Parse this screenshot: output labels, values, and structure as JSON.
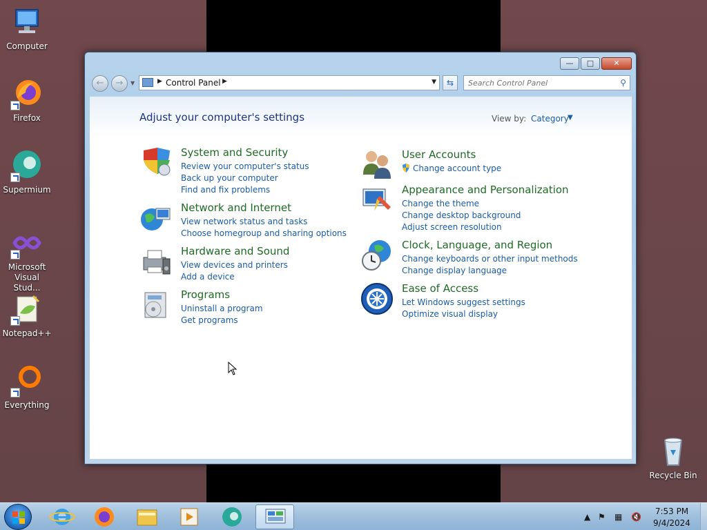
{
  "desktop": {
    "icons": [
      {
        "label": "Computer",
        "icon": "computer-icon"
      },
      {
        "label": "Firefox",
        "icon": "firefox-icon"
      },
      {
        "label": "Supermium",
        "icon": "supermium-icon"
      },
      {
        "label": "Microsoft Visual Stud...",
        "icon": "visual-studio-icon"
      },
      {
        "label": "Notepad++",
        "icon": "notepadpp-icon"
      },
      {
        "label": "Everything",
        "icon": "everything-icon"
      },
      {
        "label": "Recycle Bin",
        "icon": "recycle-bin-icon"
      }
    ]
  },
  "window": {
    "address": {
      "crumb": "Control Panel"
    },
    "search": {
      "placeholder": "Search Control Panel"
    },
    "title": "Adjust your computer's settings",
    "view_by": {
      "label": "View by:",
      "value": "Category"
    },
    "categories": [
      {
        "title": "System and Security",
        "icon": "shield-icon",
        "links": [
          "Review your computer's status",
          "Back up your computer",
          "Find and fix problems"
        ]
      },
      {
        "title": "Network and Internet",
        "icon": "network-globe-icon",
        "links": [
          "View network status and tasks",
          "Choose homegroup and sharing options"
        ]
      },
      {
        "title": "Hardware and Sound",
        "icon": "printer-icon",
        "links": [
          "View devices and printers",
          "Add a device"
        ]
      },
      {
        "title": "Programs",
        "icon": "programs-icon",
        "links": [
          "Uninstall a program",
          "Get programs"
        ]
      },
      {
        "title": "User Accounts",
        "icon": "users-icon",
        "links": [
          "Change account type"
        ]
      },
      {
        "title": "Appearance and Personalization",
        "icon": "appearance-icon",
        "links": [
          "Change the theme",
          "Change desktop background",
          "Adjust screen resolution"
        ]
      },
      {
        "title": "Clock, Language, and Region",
        "icon": "clock-globe-icon",
        "links": [
          "Change keyboards or other input methods",
          "Change display language"
        ]
      },
      {
        "title": "Ease of Access",
        "icon": "ease-of-access-icon",
        "links": [
          "Let Windows suggest settings",
          "Optimize visual display"
        ]
      }
    ]
  },
  "taskbar": {
    "apps": [
      "start-orb",
      "internet-explorer-icon",
      "firefox-icon",
      "file-explorer-icon",
      "media-player-icon",
      "supermium-icon",
      "control-panel-icon"
    ],
    "clock": {
      "time": "7:53 PM",
      "date": "9/4/2024"
    }
  }
}
